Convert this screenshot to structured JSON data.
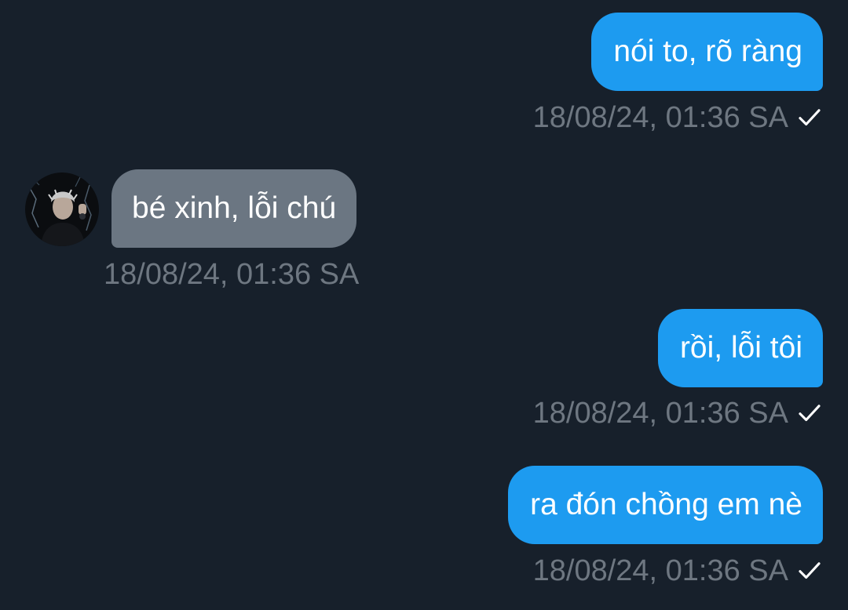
{
  "messages": [
    {
      "direction": "sent",
      "text": "nói to, rõ ràng",
      "time": "18/08/24, 01:36 SA",
      "read_icon": "check-icon"
    },
    {
      "direction": "received",
      "text": "bé xinh, lỗi chú",
      "time": "18/08/24, 01:36 SA",
      "avatar_icon": "user-avatar-photo"
    },
    {
      "direction": "sent",
      "text": "rồi, lỗi tôi",
      "time": "18/08/24, 01:36 SA",
      "read_icon": "check-icon"
    },
    {
      "direction": "sent",
      "text": "ra đón chồng em nè",
      "time": "18/08/24, 01:36 SA",
      "read_icon": "check-icon"
    }
  ],
  "colors": {
    "background": "#17202b",
    "sent_bubble": "#1d9bf0",
    "received_bubble": "#6b7682",
    "timestamp": "#6e7781",
    "bubble_text": "#ffffff"
  }
}
